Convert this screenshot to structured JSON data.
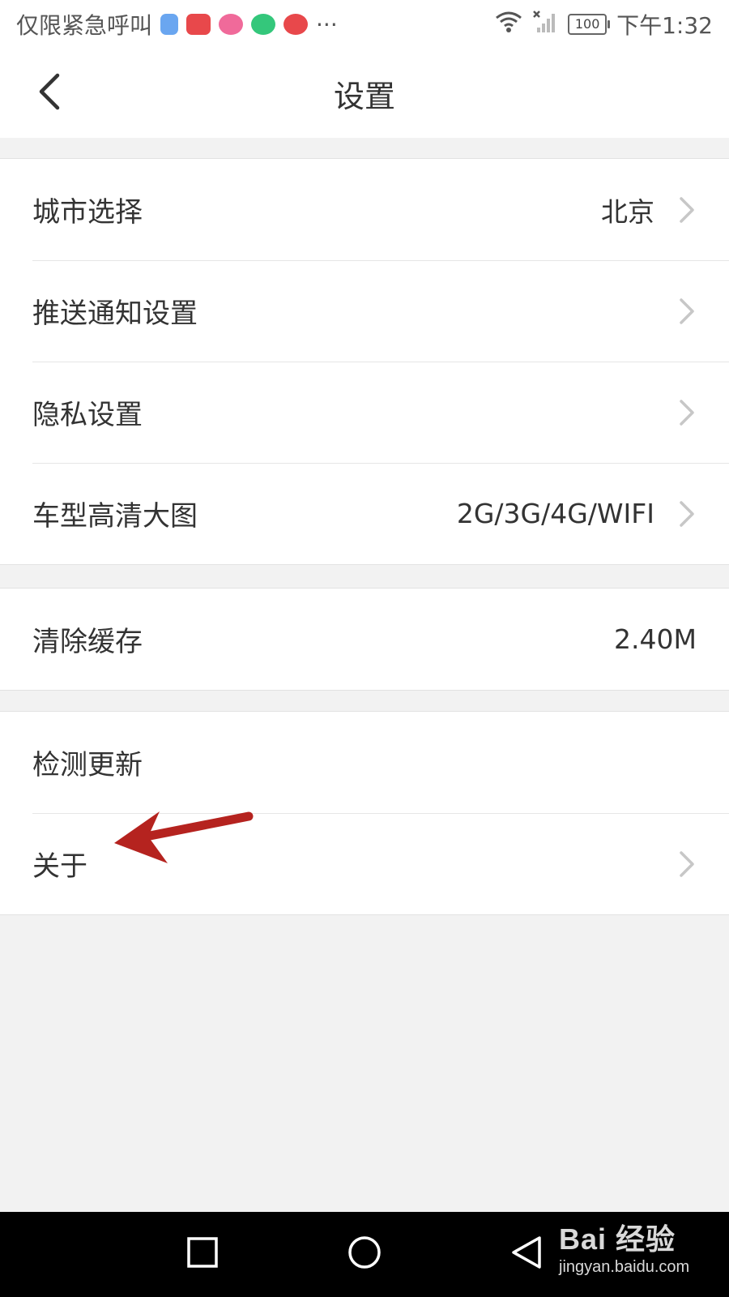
{
  "status_bar": {
    "carrier_text": "仅限紧急呼叫",
    "more_indicator": "···",
    "battery_level": "100",
    "time": "下午1:32",
    "app_icons": [
      {
        "name": "app-icon-1",
        "color": "#6aa6f0"
      },
      {
        "name": "app-icon-2",
        "color": "#e8484b"
      },
      {
        "name": "app-icon-3",
        "color": "#f06a9a"
      },
      {
        "name": "app-icon-4",
        "color": "#34c77b"
      },
      {
        "name": "app-icon-5",
        "color": "#e8484b"
      }
    ]
  },
  "nav": {
    "title": "设置",
    "back_icon": "chevron-left-icon"
  },
  "settings": {
    "city": {
      "label": "城市选择",
      "value": "北京"
    },
    "push": {
      "label": "推送通知设置"
    },
    "privacy": {
      "label": "隐私设置"
    },
    "hd_images": {
      "label": "车型高清大图",
      "value": "2G/3G/4G/WIFI"
    },
    "cache": {
      "label": "清除缓存",
      "value": "2.40M"
    },
    "update": {
      "label": "检测更新"
    },
    "about": {
      "label": "关于"
    }
  },
  "annotation": {
    "arrow_color": "#b5231f"
  },
  "system_nav": {
    "recent_icon": "square-icon",
    "home_icon": "circle-icon",
    "back_icon": "triangle-back-icon"
  },
  "watermark": {
    "logo": "Bai 经验",
    "url": "jingyan.baidu.com"
  },
  "colors": {
    "background": "#f2f2f2",
    "surface": "#ffffff",
    "divider": "#e6e6e6",
    "text": "#333333",
    "chevron": "#c7c7c7"
  }
}
